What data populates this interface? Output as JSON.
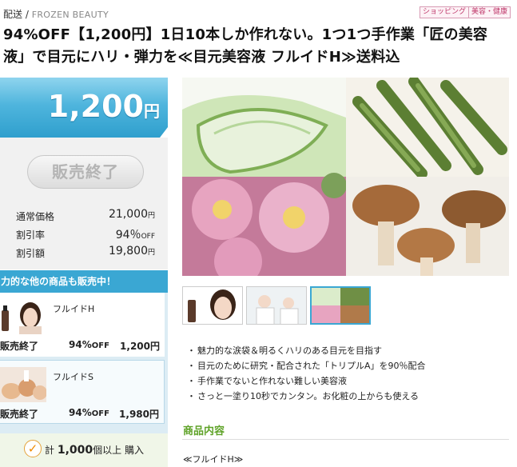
{
  "header": {
    "category": "配送",
    "separator": "/",
    "brand": "FROZEN BEAUTY",
    "tags": [
      "ショッピング",
      "美容・健康"
    ]
  },
  "title_line1": "94%OFF【1,200円】1日10本しか作れない。1つ1つ手作業「匠の美容",
  "title_line2": "液」で目元にハリ・弾力を≪目元美容液 フルイドH≫送料込",
  "price": {
    "amount": "1,200",
    "unit": "円"
  },
  "sold_out_button": "販売終了",
  "stats": [
    {
      "label": "通常価格",
      "value": "21,000",
      "unit": "円"
    },
    {
      "label": "割引率",
      "value": "94％",
      "unit": "OFF"
    },
    {
      "label": "割引額",
      "value": "19,800",
      "unit": "円"
    }
  ],
  "more_banner": "力的な他の商品も販売中！",
  "other_items": [
    {
      "name": "フルイドH",
      "status": "販売終了",
      "off_value": "94%",
      "off_unit": "OFF",
      "price": "1,200円"
    },
    {
      "name": "フルイドS",
      "status": "販売終了",
      "off_value": "94%",
      "off_unit": "OFF",
      "price": "1,980円"
    }
  ],
  "bought": {
    "prefix": "計",
    "count": "1,000",
    "suffix": "個以上 購入"
  },
  "bullets": [
    "魅力的な涙袋＆明るくハリのある目元を目指す",
    "目元のために研究・配合された「トリプルA」を90％配合",
    "手作業でないと作れない難しい美容液",
    "さっと一塗り10秒でカンタン。お化粧の上からも使える"
  ],
  "section_title": "商品内容",
  "product_name": "≪フルイドH≫",
  "colors": {
    "accent_blue": "#3aa7d3",
    "green": "#5fa328",
    "tag_pink": "#c03a6c"
  }
}
